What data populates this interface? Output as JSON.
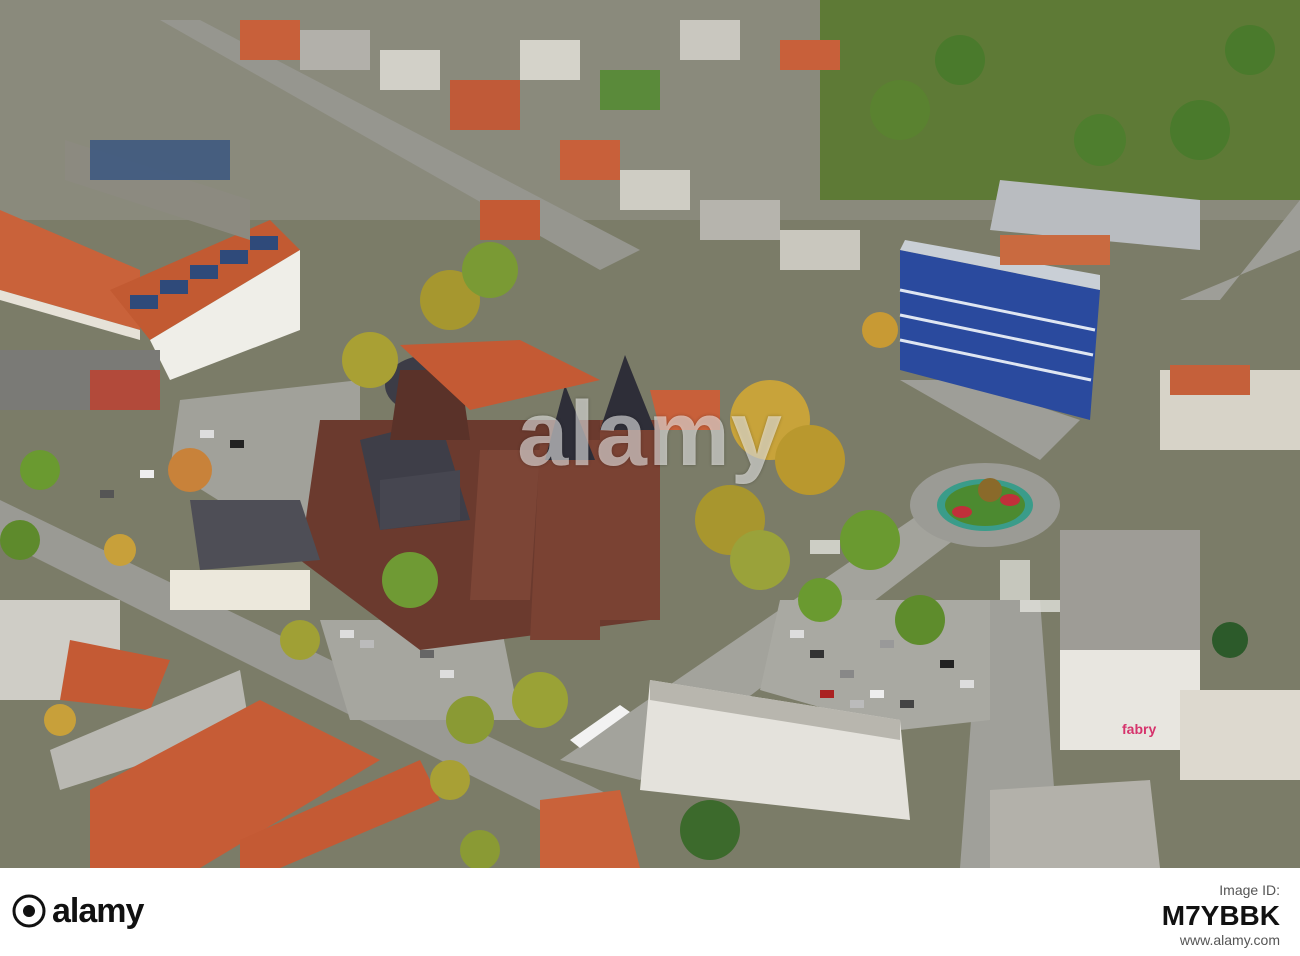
{
  "photo": {
    "store_sign": "fabry",
    "watermark": "alamy"
  },
  "footer": {
    "logo_text": "alamy",
    "image_id_label": "Image ID:",
    "image_id": "M7YBBK",
    "site_url": "www.alamy.com"
  },
  "colors": {
    "roof_red": "#c1582f",
    "grass": "#6f8c3a",
    "road": "#9a9a94",
    "church_stone": "#6b3a2e",
    "office_blue": "#2a4a9e",
    "sign_pink": "#d6336c"
  }
}
